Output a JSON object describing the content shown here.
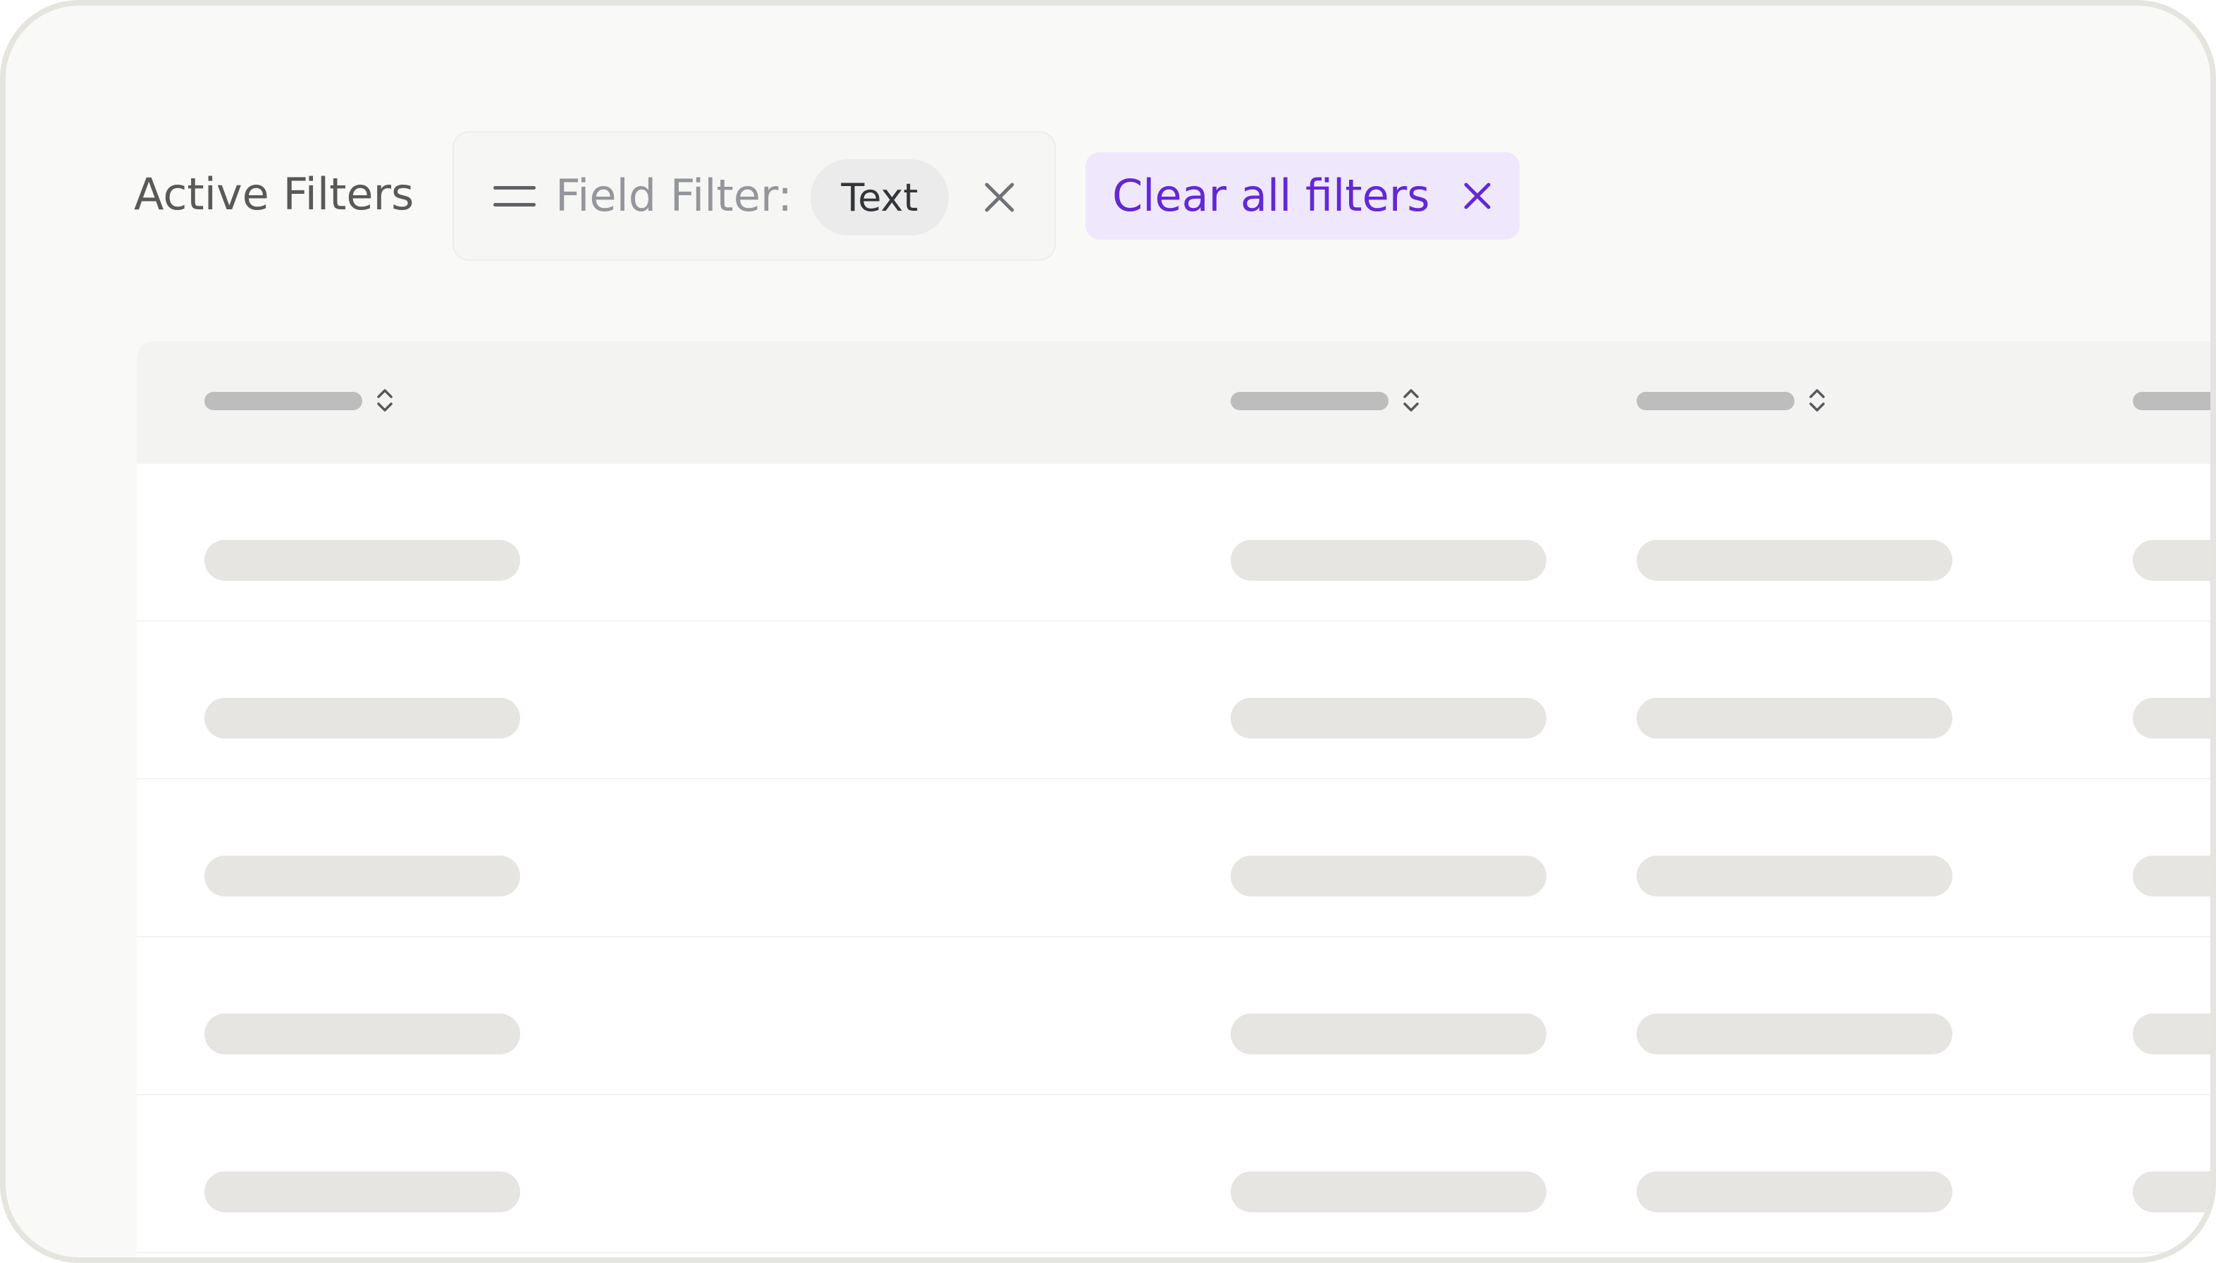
{
  "filters": {
    "label": "Active Filters",
    "field_filter": {
      "label": "Field Filter:",
      "value": "Text",
      "icon": "lines-icon",
      "remove_icon": "close-icon"
    },
    "clear_all": {
      "label": "Clear all filters",
      "icon": "close-icon"
    }
  },
  "table": {
    "sort_icon": "sort-icon",
    "column_count": 4,
    "row_count": 5,
    "loading": true
  },
  "colors": {
    "accent": "#6228d6",
    "accent_bg": "#efe8fc",
    "placeholder": "#e6e5e2",
    "header_placeholder": "#bdbdbd"
  }
}
